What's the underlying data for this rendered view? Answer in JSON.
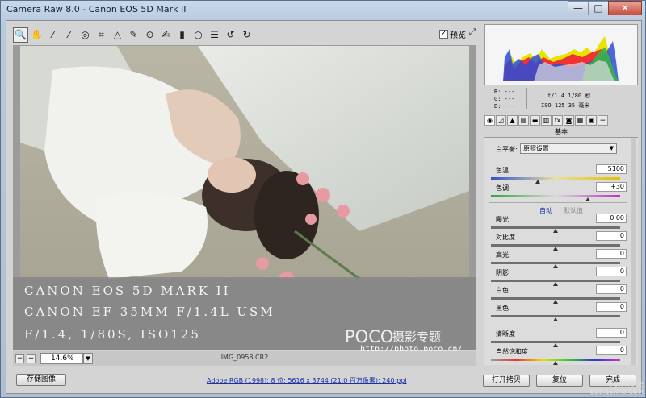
{
  "window": {
    "title": "Camera Raw 8.0  -  Canon EOS 5D Mark II",
    "controls": {
      "minimize": "—",
      "maximize": "□",
      "close": "✕"
    }
  },
  "toolbar": {
    "tools": [
      {
        "icon": "zoom-icon",
        "glyph": "🔍"
      },
      {
        "icon": "hand-icon",
        "glyph": "✋"
      },
      {
        "icon": "white-balance-icon",
        "glyph": "⁄"
      },
      {
        "icon": "color-sampler-icon",
        "glyph": "⁄"
      },
      {
        "icon": "target-adjust-icon",
        "glyph": "◎"
      },
      {
        "icon": "crop-icon",
        "glyph": "⌗"
      },
      {
        "icon": "straighten-icon",
        "glyph": "△"
      },
      {
        "icon": "spot-removal-icon",
        "glyph": "✎"
      },
      {
        "icon": "red-eye-icon",
        "glyph": "⊙"
      },
      {
        "icon": "adjustment-brush-icon",
        "glyph": "✍"
      },
      {
        "icon": "graduated-filter-icon",
        "glyph": "▮"
      },
      {
        "icon": "radial-filter-icon",
        "glyph": "○"
      },
      {
        "icon": "preferences-icon",
        "glyph": "☰"
      },
      {
        "icon": "rotate-left-icon",
        "glyph": "↺"
      },
      {
        "icon": "rotate-right-icon",
        "glyph": "↻"
      }
    ],
    "preview_label": "预览",
    "preview_checked": true
  },
  "image": {
    "caption_lines": [
      "CANON EOS 5D MARK II",
      "CANON EF 35MM F/1.4L USM",
      "F/1.4, 1/80S, ISO125"
    ],
    "brand": "POCO",
    "brand_cn": "摄影专题",
    "url": "http://photo.poco.cn/"
  },
  "status": {
    "zoom": "14.6%",
    "filename": "IMG_0958.CR2"
  },
  "histogram": {
    "r": "R: ---",
    "g": "G: ---",
    "b": "B: ---",
    "aperture_shutter": "f/1.4   1/80 秒",
    "iso_focal": "ISO 125   35 毫米"
  },
  "panel": {
    "title": "基本",
    "wb_label": "白平衡:",
    "wb_value": "原照设置",
    "auto": "自动",
    "default": "默认值",
    "sliders": [
      {
        "label": "色温",
        "value": "5100",
        "pos": 0.36,
        "track": "temp"
      },
      {
        "label": "色调",
        "value": "+30",
        "pos": 0.75,
        "track": "tint"
      },
      {
        "label": "曝光",
        "value": "0.00",
        "pos": 0.5,
        "track": "gray"
      },
      {
        "label": "对比度",
        "value": "0",
        "pos": 0.5,
        "track": "gray"
      },
      {
        "label": "高光",
        "value": "0",
        "pos": 0.5,
        "track": "gray"
      },
      {
        "label": "阴影",
        "value": "0",
        "pos": 0.5,
        "track": "gray"
      },
      {
        "label": "白色",
        "value": "0",
        "pos": 0.5,
        "track": "gray"
      },
      {
        "label": "黑色",
        "value": "0",
        "pos": 0.5,
        "track": "gray"
      },
      {
        "label": "清晰度",
        "value": "0",
        "pos": 0.5,
        "track": "gray"
      },
      {
        "label": "自然饱和度",
        "value": "0",
        "pos": 0.5,
        "track": "sat"
      }
    ]
  },
  "bottom": {
    "save": "存储图像",
    "workflow": "Adobe RGB (1998); 8 位; 5616 x 3744 (21.0 百万像素); 240 ppi",
    "open": "打开拷贝",
    "reset": "复位",
    "done": "完成",
    "watermark1": "PS教程论坛",
    "watermark2": "BBS.16XX8.COM"
  }
}
